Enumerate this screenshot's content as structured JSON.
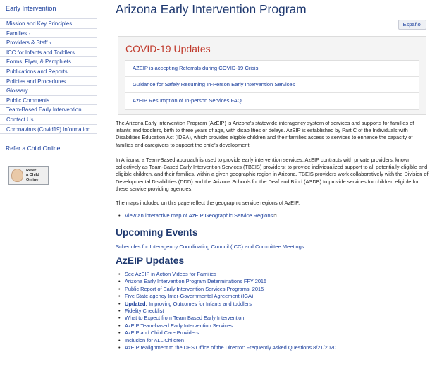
{
  "sidebar": {
    "title": "Early Intervention",
    "items": [
      {
        "label": "Mission and Key Principles",
        "arrow": ""
      },
      {
        "label": "Families",
        "arrow": "›"
      },
      {
        "label": "Providers & Staff",
        "arrow": "›"
      },
      {
        "label": "ICC for Infants and Toddlers",
        "arrow": ""
      },
      {
        "label": "Forms, Flyer, & Pamphlets",
        "arrow": ""
      },
      {
        "label": "Publications and Reports",
        "arrow": ""
      },
      {
        "label": "Policies and Procedures",
        "arrow": ""
      },
      {
        "label": "Glossary",
        "arrow": ""
      },
      {
        "label": "Public Comments",
        "arrow": ""
      },
      {
        "label": "Team-Based Early Intervention",
        "arrow": ""
      },
      {
        "label": "Contact Us",
        "arrow": ""
      },
      {
        "label": "Coronavirus (Covid19) Information",
        "arrow": ""
      }
    ],
    "refer_link": "Refer a Child Online",
    "badge_text": [
      "Refer",
      "a Child",
      "Online"
    ]
  },
  "main": {
    "title": "Arizona Early Intervention Program",
    "language_button": "Español",
    "covid": {
      "title": "COVID-19 Updates",
      "links": [
        "AZEIP is accepting Referrals during COVID-19 Crisis",
        "Guidance for Safely Resuming In-Person Early Intervention Services",
        "AzEIP Resumption of In-person Services FAQ"
      ]
    },
    "paragraphs": [
      "The Arizona Early Intervention Program (AzEIP) is Arizona's statewide interagency system of services and supports for families of infants and toddlers, birth to three years of age, with disabilities or delays. AzEIP is established by Part C of the Individuals with Disabilities Education Act (IDEA), which provides eligible children and their families access to services to enhance the capacity of families and caregivers to support the child's development.",
      "In Arizona, a Team-Based approach is used to provide early intervention services. AzEIP contracts with private providers, known collectively as Team-Based Early Intervention Services (TBEIS) providers; to provide individualized support to all potentially-eligible and eligible children, and their families, within a given geographic region in Arizona. TBEIS providers work collaboratively with the Division of Developmental Disabilities (DDD) and the Arizona Schools for the Deaf and Blind (ASDB) to provide services for children eligible for these service providing agencies.",
      "The maps included on this page reflect the geographic service regions of AzEIP."
    ],
    "map_link": "View an interactive map of AzEIP Geographic Service Regions",
    "upcoming_events": {
      "heading": "Upcoming Events",
      "link": "Schedules for Interagency Coordinating Council (ICC) and Committee Meetings"
    },
    "updates": {
      "heading": "AzEIP Updates",
      "items": [
        {
          "prefix": "",
          "text": "See AzEIP in Action Videos for Families"
        },
        {
          "prefix": "",
          "text": "Arizona Early Intervention Program Determinations FFY 2015"
        },
        {
          "prefix": "",
          "text": "Public Report of Early Intervention Services Programs, 2015"
        },
        {
          "prefix": "",
          "text": "Five State agency Inter-Governmental Agreement (IGA)"
        },
        {
          "prefix": "Updated:",
          "text": " Improving Outcomes for Infants and toddlers"
        },
        {
          "prefix": "",
          "text": "Fidelity Checklist"
        },
        {
          "prefix": "",
          "text": "What to Expect from Team Based Early Intervention"
        },
        {
          "prefix": "",
          "text": "AzEIP Team-based Early Intervention Services"
        },
        {
          "prefix": "",
          "text": "AzEIP and Child Care Providers"
        },
        {
          "prefix": "",
          "text": "Inclusion for ALL Children"
        },
        {
          "prefix": "",
          "text": "AzEIP realignment to the DES Office of the Director: Frequently Asked Questions 8/21/2020"
        }
      ]
    }
  }
}
